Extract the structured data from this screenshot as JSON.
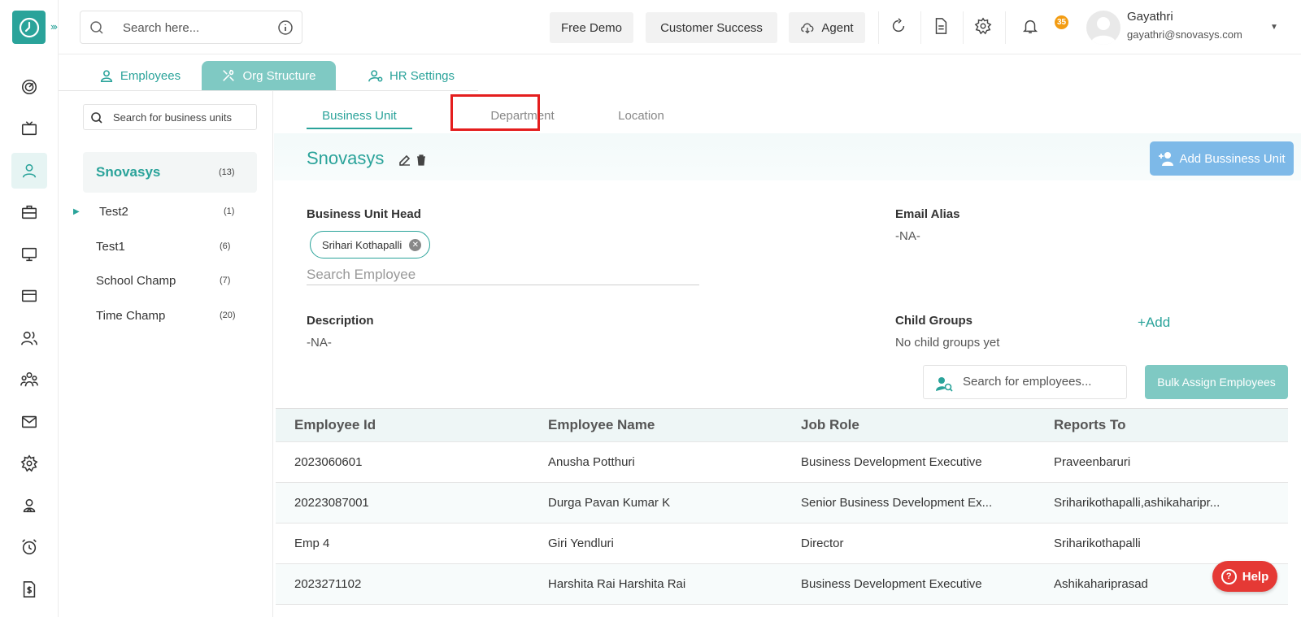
{
  "topbar": {
    "search_placeholder": "Search here...",
    "free_demo": "Free Demo",
    "customer_success": "Customer Success",
    "agent": "Agent",
    "notification_count": "35",
    "user_name": "Gayathri",
    "user_email": "gayathri@snovasys.com"
  },
  "main_tabs": {
    "employees": "Employees",
    "org_structure": "Org Structure",
    "hr_settings": "HR Settings"
  },
  "left_panel": {
    "search_placeholder": "Search for business units",
    "units": [
      {
        "name": "Snovasys",
        "count": "(13)"
      },
      {
        "name": "Test2",
        "count": "(1)"
      },
      {
        "name": "Test1",
        "count": "(6)"
      },
      {
        "name": "School Champ",
        "count": "(7)"
      },
      {
        "name": "Time Champ",
        "count": "(20)"
      }
    ]
  },
  "sub_tabs": {
    "business_unit": "Business Unit",
    "department": "Department",
    "location": "Location"
  },
  "detail": {
    "title": "Snovasys",
    "add_button": "Add Bussiness Unit",
    "head_label": "Business Unit Head",
    "head_chip": "Srihari Kothapalli",
    "employee_search_placeholder": "Search Employee",
    "email_alias_label": "Email Alias",
    "email_alias_value": "-NA-",
    "description_label": "Description",
    "description_value": "-NA-",
    "child_groups_label": "Child Groups",
    "child_groups_value": "No child groups yet",
    "add_link": "+Add",
    "table_search_placeholder": "Search for employees...",
    "bulk_button": "Bulk Assign Employees"
  },
  "table": {
    "headers": [
      "Employee Id",
      "Employee Name",
      "Job Role",
      "Reports To"
    ],
    "rows": [
      [
        "2023060601",
        "Anusha Potthuri",
        "Business Development Executive",
        "Praveenbaruri"
      ],
      [
        "20223087001",
        "Durga Pavan Kumar K",
        "Senior Business Development Ex...",
        "Sriharikothapalli,ashikaharipr..."
      ],
      [
        "Emp 4",
        "Giri Yendluri",
        "Director",
        "Sriharikothapalli"
      ],
      [
        "2023271102",
        "Harshita Rai Harshita Rai",
        "Business Development Executive",
        "Ashikahariprasad"
      ]
    ]
  },
  "help": {
    "label": "Help",
    "glyph": "?"
  },
  "colors": {
    "accent": "#2aa39a",
    "highlight": "#e41e1e",
    "add_button": "#7db9e8",
    "help": "#e53935"
  }
}
